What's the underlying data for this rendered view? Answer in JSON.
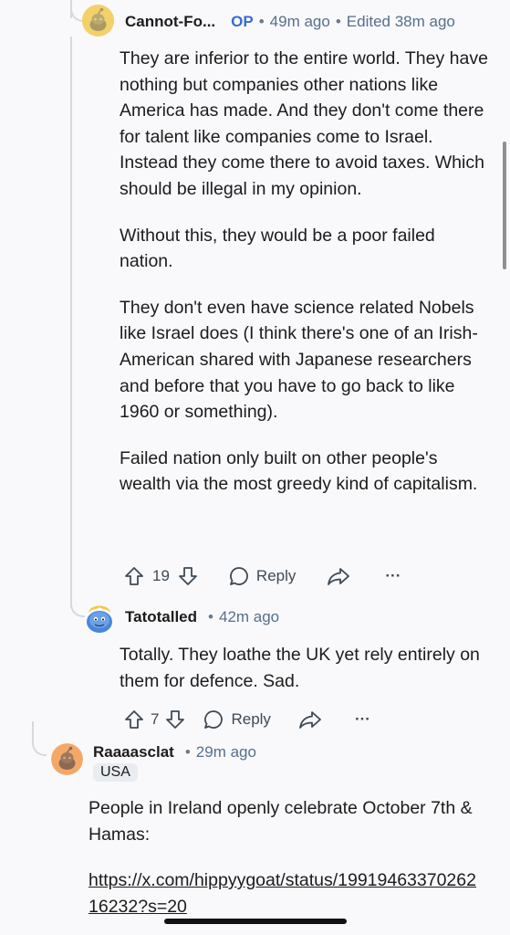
{
  "comments": [
    {
      "author": "Cannot-Fo...",
      "op_label": "OP",
      "time": "49m ago",
      "edited": "Edited 38m ago",
      "paragraphs": [
        "They are inferior to the entire world. They have nothing but companies other nations like America has made. And they don't come there for talent like companies come to Israel. Instead they come there to avoid taxes. Which should be illegal in my opinion.",
        "Without this, they would be a poor failed nation.",
        "They don't even have science related Nobels like Israel does (I think there's one of an Irish-American shared with Japanese researchers and before that you have to go back to like 1960 or something).",
        "Failed nation only built on other people's wealth via the most greedy kind of capitalism."
      ],
      "votes": "19",
      "reply_label": "Reply",
      "more_label": "···"
    },
    {
      "author": "Tatotalled",
      "time": "42m ago",
      "paragraphs": [
        "Totally. They loathe the UK yet rely entirely on them for defence. Sad."
      ],
      "votes": "7",
      "reply_label": "Reply",
      "more_label": "···"
    },
    {
      "author": "Raaaasclat",
      "time": "29m ago",
      "flair": "USA",
      "paragraphs": [
        "People in Ireland openly celebrate October 7th & Hamas:"
      ],
      "link": "https://x.com/hippyygoat/status/1991946337026216232?s=20"
    }
  ],
  "icons": {
    "upvote": "arrow-up-icon",
    "downvote": "arrow-down-icon",
    "reply": "speech-bubble-icon",
    "share": "share-icon",
    "more": "ellipsis-icon"
  }
}
